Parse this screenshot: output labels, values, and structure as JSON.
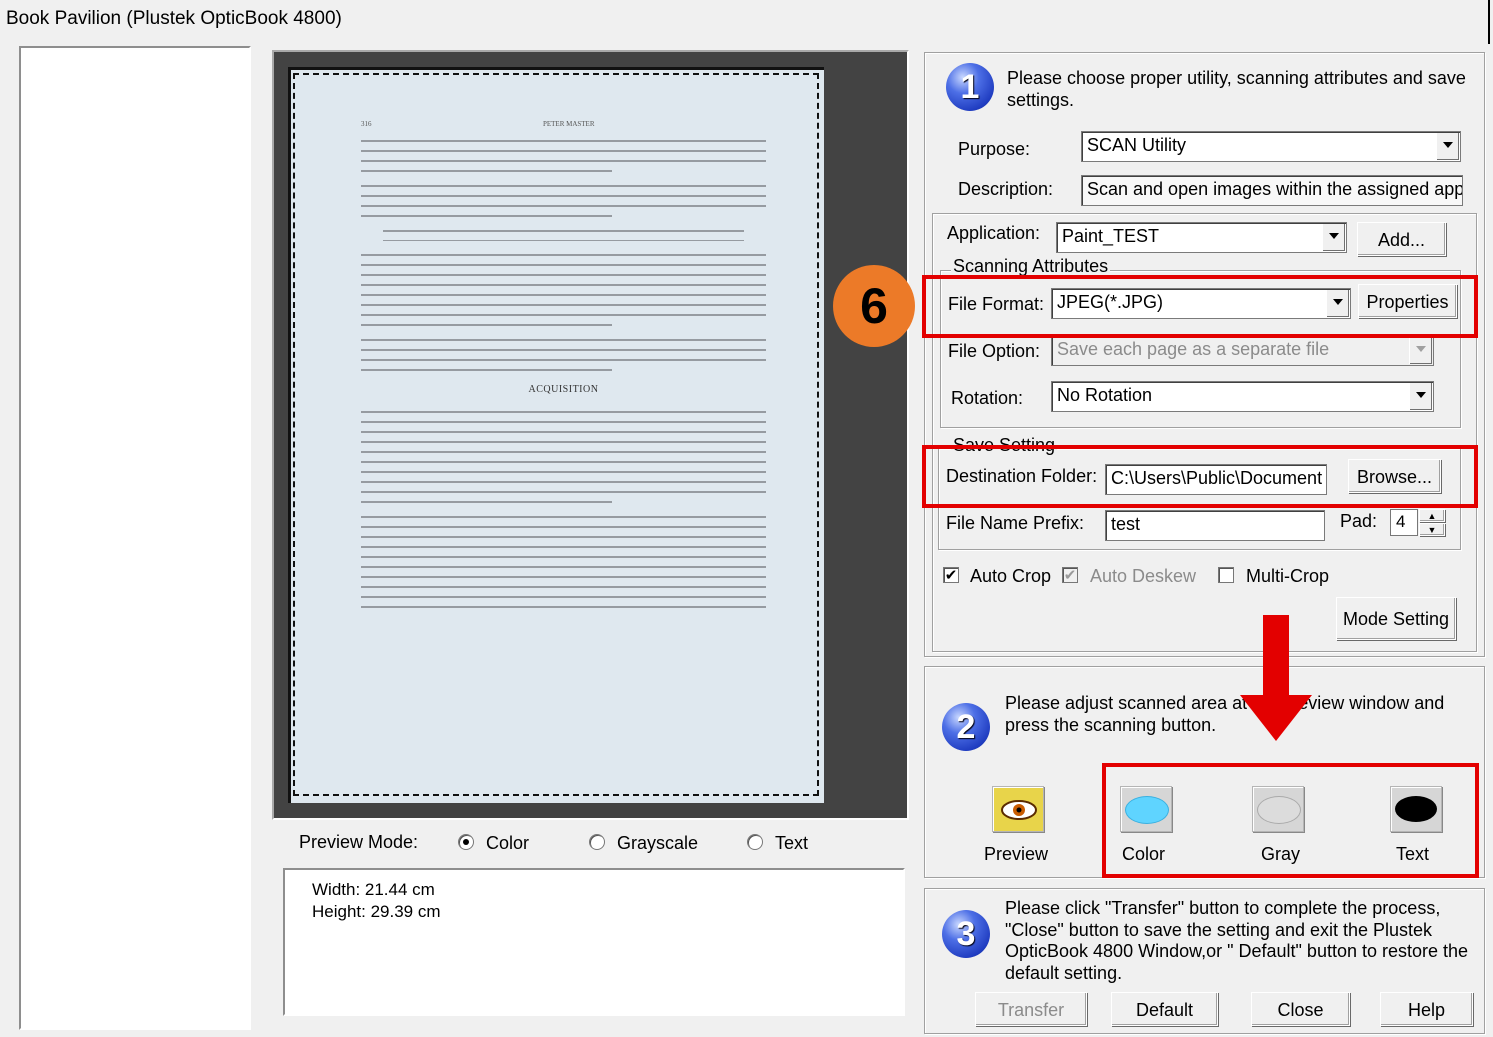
{
  "window": {
    "title": "Book Pavilion (Plustek OpticBook 4800)"
  },
  "page_doc": {
    "header_left": "316",
    "header_center": "PETER MASTER",
    "section_heading": "ACQUISITION"
  },
  "preview": {
    "mode_label": "Preview Mode:",
    "options": [
      {
        "label": "Color",
        "selected": true
      },
      {
        "label": "Grayscale",
        "selected": false
      },
      {
        "label": "Text",
        "selected": false
      }
    ],
    "width_text": "Width: 21.44 cm",
    "height_text": "Height: 29.39 cm"
  },
  "step1": {
    "number": "1",
    "text": "Please choose proper utility, scanning attributes and save settings.",
    "purpose_label": "Purpose:",
    "purpose_value": "SCAN Utility",
    "description_label": "Description:",
    "description_value": "Scan and open images within the assigned appli",
    "application_label": "Application:",
    "application_value": "Paint_TEST",
    "add_label": "Add...",
    "scanning_attributes_legend": "Scanning Attributes",
    "file_format_label": "File Format:",
    "file_format_value": "JPEG(*.JPG)",
    "properties_label": "Properties",
    "file_option_label": "File Option:",
    "file_option_value": "Save each page as a separate file",
    "rotation_label": "Rotation:",
    "rotation_value": "No Rotation",
    "save_setting_legend": "Save Setting",
    "destination_label": "Destination Folder:",
    "destination_value": "C:\\Users\\Public\\Document",
    "browse_label": "Browse...",
    "prefix_label": "File Name Prefix:",
    "prefix_value": "test",
    "pad_label": "Pad:",
    "pad_value": "4",
    "auto_crop_label": "Auto Crop",
    "auto_deskew_label": "Auto Deskew",
    "multi_crop_label": "Multi-Crop",
    "mode_setting_label": "Mode Setting"
  },
  "annotation": {
    "badge": "6",
    "arrow_color": "#e30000",
    "box_color": "#e30000",
    "badge_color": "#ec7a28"
  },
  "step2": {
    "number": "2",
    "text": "Please adjust scanned area at the preview window and press the scanning button.",
    "preview_label": "Preview",
    "color_label": "Color",
    "gray_label": "Gray",
    "text_label": "Text"
  },
  "step3": {
    "number": "3",
    "text": "Please click \"Transfer\" button to complete the process, \"Close\" button to save the setting and exit the Plustek OpticBook 4800 Window,or \" Default\" button to restore the default setting.",
    "transfer_label": "Transfer",
    "default_label": "Default",
    "close_label": "Close",
    "help_label": "Help"
  }
}
